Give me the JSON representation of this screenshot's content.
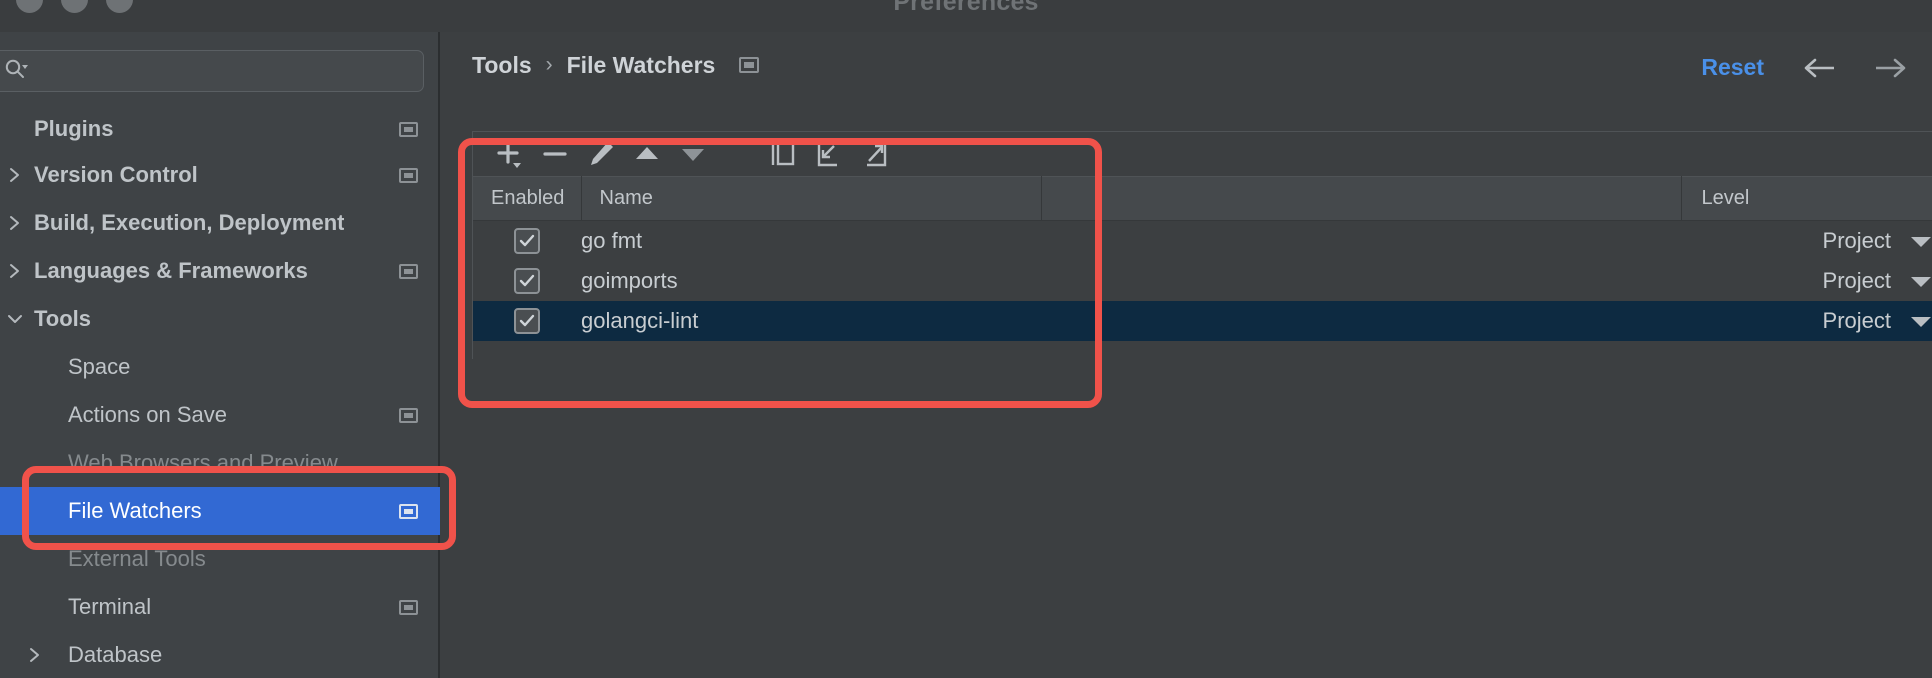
{
  "window": {
    "title": "Preferences",
    "traffic_lights": [
      "close",
      "minimize",
      "zoom"
    ]
  },
  "sidebar": {
    "search": {
      "value": "",
      "placeholder": "",
      "icon": "search-icon",
      "dropdown_icon": "chevron-down-icon"
    },
    "items": [
      {
        "label": "Plugins",
        "level": 0,
        "twisty": "",
        "badge": true,
        "selected": false,
        "clipped": true
      },
      {
        "label": "Version Control",
        "level": 0,
        "twisty": "right",
        "badge": true,
        "selected": false
      },
      {
        "label": "Build, Execution, Deployment",
        "level": 0,
        "twisty": "right",
        "badge": false,
        "selected": false
      },
      {
        "label": "Languages & Frameworks",
        "level": 0,
        "twisty": "right",
        "badge": true,
        "selected": false
      },
      {
        "label": "Tools",
        "level": 0,
        "twisty": "down",
        "badge": false,
        "selected": false
      },
      {
        "label": "Space",
        "level": 1,
        "twisty": "",
        "badge": false,
        "selected": false
      },
      {
        "label": "Actions on Save",
        "level": 1,
        "twisty": "",
        "badge": true,
        "selected": false
      },
      {
        "label": "Web Browsers and Preview",
        "level": 1,
        "twisty": "",
        "badge": false,
        "selected": false,
        "faded": true
      },
      {
        "label": "File Watchers",
        "level": 1,
        "twisty": "",
        "badge": true,
        "selected": true
      },
      {
        "label": "External Tools",
        "level": 1,
        "twisty": "",
        "badge": false,
        "selected": false,
        "faded": true
      },
      {
        "label": "Terminal",
        "level": 1,
        "twisty": "",
        "badge": true,
        "selected": false
      },
      {
        "label": "Database",
        "level": 1,
        "twisty": "right",
        "badge": false,
        "selected": false
      }
    ]
  },
  "header": {
    "breadcrumb": [
      "Tools",
      "File Watchers"
    ],
    "separator": "›",
    "badge_icon": "project-scope-icon",
    "reset_label": "Reset",
    "back_icon": "arrow-left-icon",
    "forward_icon": "arrow-right-icon"
  },
  "toolbar": {
    "buttons": [
      {
        "name": "add-watcher-button",
        "icon": "plus-icon",
        "has_dropdown": true
      },
      {
        "name": "remove-watcher-button",
        "icon": "minus-icon",
        "has_dropdown": false
      },
      {
        "name": "edit-watcher-button",
        "icon": "pencil-icon",
        "has_dropdown": false
      },
      {
        "name": "move-up-button",
        "icon": "triangle-up-icon",
        "has_dropdown": false
      },
      {
        "name": "move-down-button",
        "icon": "triangle-down-icon",
        "has_dropdown": false
      },
      {
        "name": "copy-watcher-button",
        "icon": "copy-icon",
        "has_dropdown": false
      },
      {
        "name": "import-watchers-button",
        "icon": "import-icon",
        "has_dropdown": false
      },
      {
        "name": "export-watchers-button",
        "icon": "export-icon",
        "has_dropdown": false
      }
    ]
  },
  "table": {
    "columns": [
      "Enabled",
      "Name",
      "",
      "Level"
    ],
    "rows": [
      {
        "enabled": true,
        "name": "go fmt",
        "level": "Project",
        "selected": false
      },
      {
        "enabled": true,
        "name": "goimports",
        "level": "Project",
        "selected": false
      },
      {
        "enabled": true,
        "name": "golangci-lint",
        "level": "Project",
        "selected": true
      }
    ],
    "checkmark": "✓",
    "level_dropdown_icon": "chevron-down-icon"
  },
  "annotations": [
    {
      "name": "annotation-table-highlight",
      "color": "#f0524a"
    },
    {
      "name": "annotation-sidebar-highlight",
      "color": "#f0524a"
    }
  ],
  "colors": {
    "accent_blue": "#3269d3",
    "link_blue": "#4a90e8",
    "annotation_red": "#f0524a",
    "selected_row": "#0d2a41",
    "sidebar_bg": "#3f4346",
    "panel_bg": "#3c3f41"
  }
}
